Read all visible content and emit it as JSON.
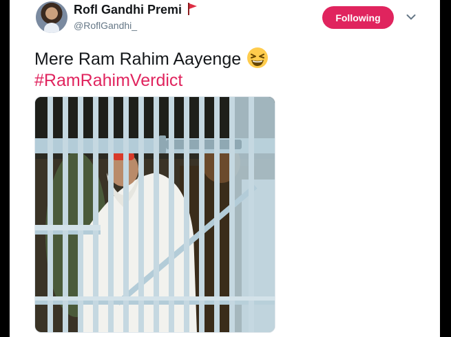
{
  "tweet": {
    "display_name": "Rofl Gandhi Premi",
    "handle": "@RoflGandhi_",
    "follow_label": "Following",
    "text": "Mere Ram Rahim Aayenge",
    "hashtag": "#RamRahimVerdict"
  },
  "icons": {
    "avatar": "profile-photo",
    "flag": "red-flag-icon",
    "emoji": "grinning-squinting-face",
    "menu": "chevron-down-icon"
  },
  "colors": {
    "accent": "#e0245e",
    "text": "#14171a",
    "secondary": "#657786"
  }
}
